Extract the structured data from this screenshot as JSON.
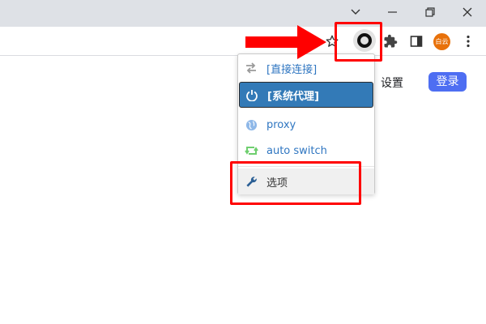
{
  "window_controls": {
    "dropdown_icon": "chevron-down",
    "minimize_icon": "minimize",
    "restore_icon": "restore",
    "close_icon": "close"
  },
  "toolbar": {
    "icons": [
      "star",
      "proxy-switch-circle",
      "puzzle",
      "side-panel",
      "kebab-menu"
    ],
    "avatar_text": "白云"
  },
  "page": {
    "settings_label": "设置",
    "login_label": "登录",
    "login_color": "#4e6ef2"
  },
  "popup_menu": {
    "items": [
      {
        "label": "[直接连接]",
        "icon": "transfer-arrows",
        "selected": false
      },
      {
        "label": "[系统代理]",
        "icon": "power",
        "selected": true
      },
      {
        "label": "proxy",
        "icon": "globe",
        "selected": false
      },
      {
        "label": "auto switch",
        "icon": "retweet",
        "selected": false
      },
      {
        "label": "选项",
        "icon": "wrench",
        "selected": false
      }
    ],
    "selected_color": "#337ab7"
  },
  "annotations": {
    "color": "#ff0000"
  }
}
